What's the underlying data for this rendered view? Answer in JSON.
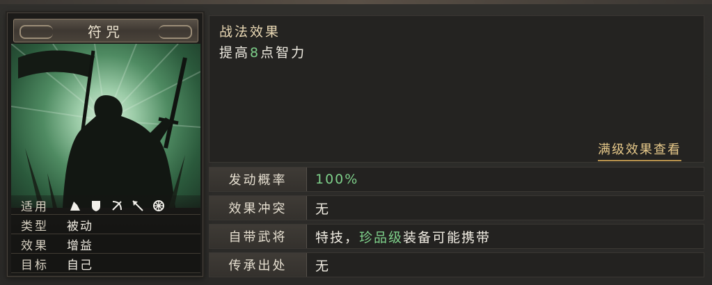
{
  "card": {
    "title": "符咒",
    "info": [
      {
        "label": "适用",
        "icons": [
          "cavalry-icon",
          "shield-icon",
          "bow-icon",
          "spear-icon",
          "wheel-icon"
        ]
      },
      {
        "label": "类型",
        "value": "被动"
      },
      {
        "label": "效果",
        "value": "增益"
      },
      {
        "label": "目标",
        "value": "自己"
      }
    ]
  },
  "effect": {
    "title": "战法效果",
    "text_prefix": "提高",
    "text_number": "8",
    "text_suffix": "点智力",
    "max_level_link": "满级效果查看"
  },
  "attributes": [
    {
      "key": "发动概率",
      "value": "100%"
    },
    {
      "key": "效果冲突",
      "value": "无"
    },
    {
      "key": "自带武将",
      "value_prefix": "特技，",
      "value_highlight": "珍品级",
      "value_suffix": "装备可能携带"
    },
    {
      "key": "传承出处",
      "value": "无"
    }
  ],
  "colors": {
    "highlight_green": "#7ed08a",
    "link_gold": "#e7c98a",
    "art_green": "#4f8b62"
  }
}
